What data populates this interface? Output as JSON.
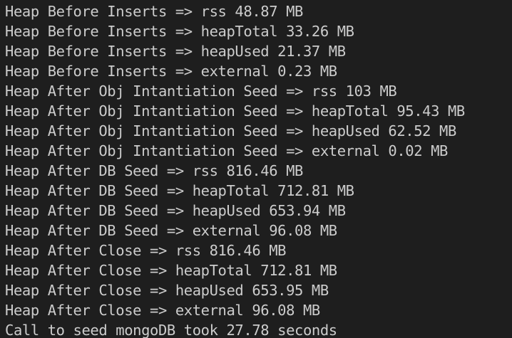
{
  "terminal": {
    "lines": [
      "Heap Before Inserts => rss 48.87 MB",
      "Heap Before Inserts => heapTotal 33.26 MB",
      "Heap Before Inserts => heapUsed 21.37 MB",
      "Heap Before Inserts => external 0.23 MB",
      "Heap After Obj Intantiation Seed => rss 103 MB",
      "Heap After Obj Intantiation Seed => heapTotal 95.43 MB",
      "Heap After Obj Intantiation Seed => heapUsed 62.52 MB",
      "Heap After Obj Intantiation Seed => external 0.02 MB",
      "Heap After DB Seed => rss 816.46 MB",
      "Heap After DB Seed => heapTotal 712.81 MB",
      "Heap After DB Seed => heapUsed 653.94 MB",
      "Heap After DB Seed => external 96.08 MB",
      "Heap After Close => rss 816.46 MB",
      "Heap After Close => heapTotal 712.81 MB",
      "Heap After Close => heapUsed 653.95 MB",
      "Heap After Close => external 96.08 MB",
      "Call to seed mongoDB took 27.78 seconds"
    ]
  }
}
